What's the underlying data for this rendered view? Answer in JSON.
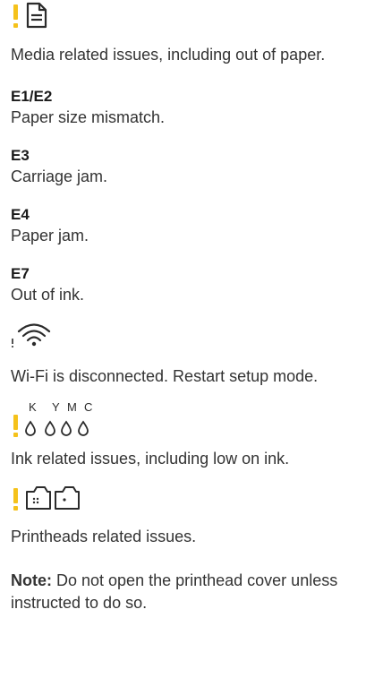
{
  "media": {
    "description": "Media related issues, including out of paper."
  },
  "errors": [
    {
      "code": "E1/E2",
      "text": "Paper size mismatch."
    },
    {
      "code": "E3",
      "text": "Carriage jam."
    },
    {
      "code": "E4",
      "text": "Paper jam."
    },
    {
      "code": "E7",
      "text": "Out of ink."
    }
  ],
  "wifi": {
    "description": "Wi-Fi is disconnected. Restart setup mode."
  },
  "ink": {
    "labels": [
      "K",
      "Y",
      "M",
      "C"
    ],
    "description": "Ink related issues, including low on ink."
  },
  "printheads": {
    "description": "Printheads related issues."
  },
  "note": {
    "label": "Note:",
    "text": " Do not open the printhead cover unless instructed to do so."
  },
  "colors": {
    "warning": "#f5c21b",
    "text": "#333333"
  }
}
